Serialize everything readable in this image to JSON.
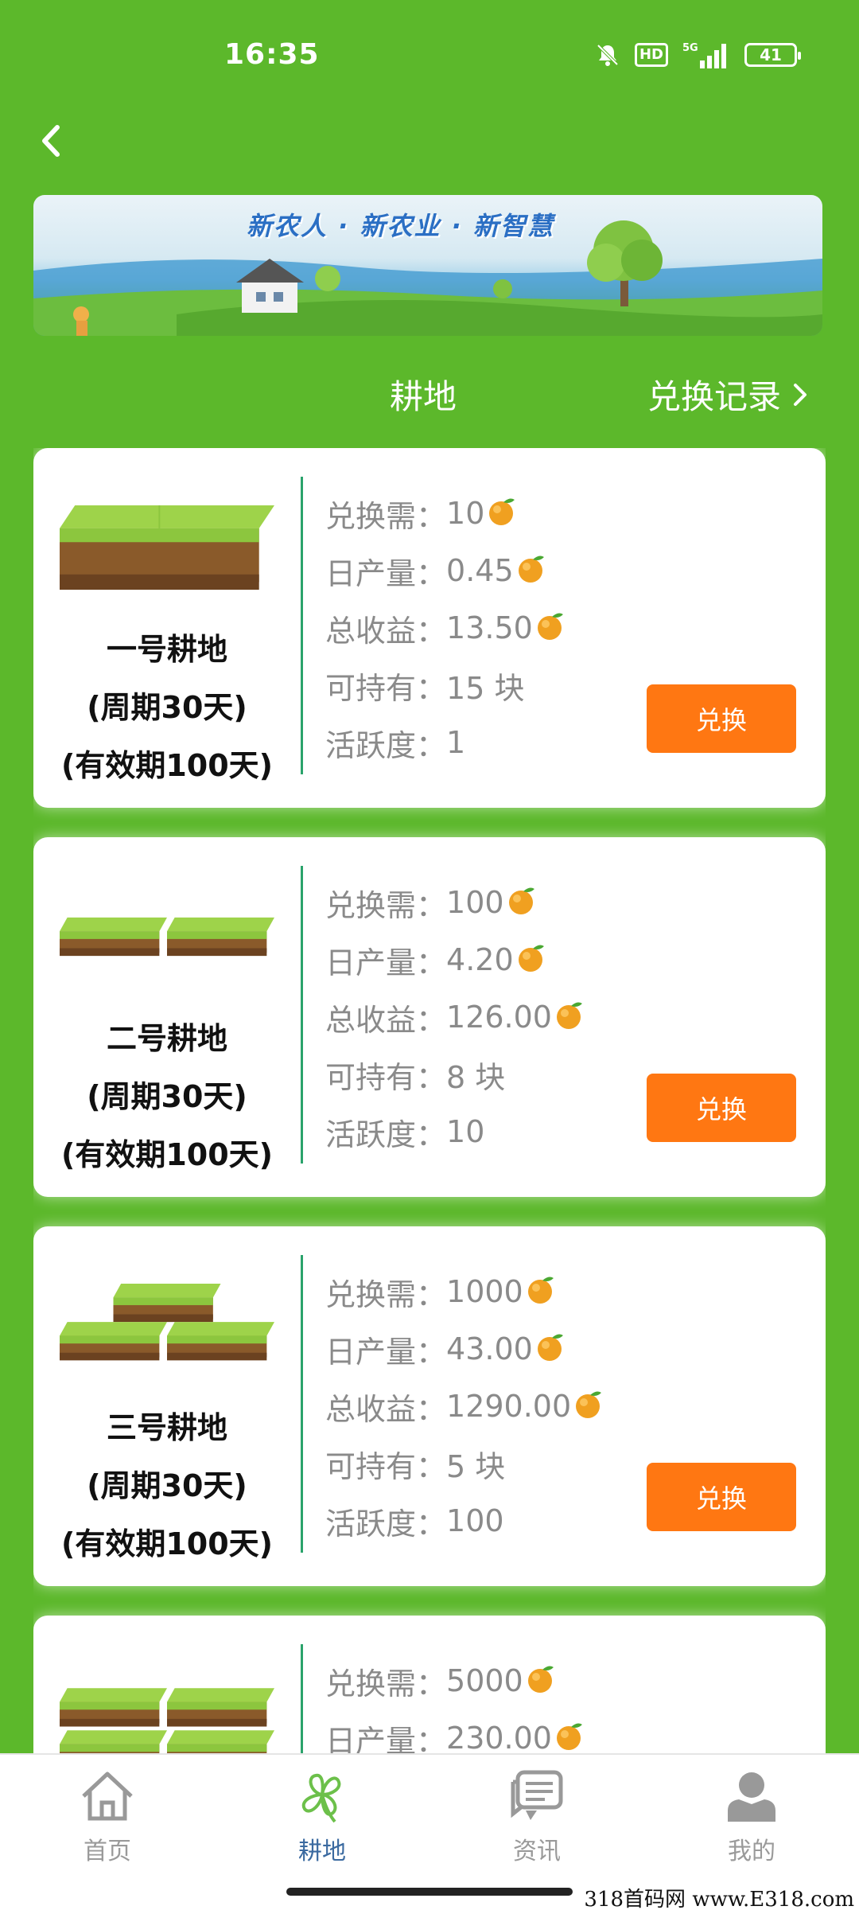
{
  "status_bar": {
    "time": "16:35",
    "hd_label": "HD",
    "network_label": "5G",
    "battery_level": "41",
    "icons": [
      "bell-muted-icon",
      "hd-icon",
      "signal-5g-icon",
      "battery-icon"
    ]
  },
  "header": {
    "back_icon": "chevron-left-icon",
    "banner_slogan": "新农人 · 新农业 · 新智慧"
  },
  "tabs": {
    "title": "耕地",
    "record_link": "兑换记录"
  },
  "colors": {
    "background": "#5cb82b",
    "button": "#ff7712",
    "divider": "#2aa36b",
    "nav_active": "#3b6aa0"
  },
  "labels": {
    "cost": "兑换需：",
    "daily": "日产量：",
    "total": "总收益：",
    "hold": "可持有：",
    "activity": "活跃度：",
    "button": "兑换"
  },
  "cards": [
    {
      "name": "一号耕地",
      "cycle": "(周期30天)",
      "validity": "(有效期100天)",
      "cost": "10",
      "daily": "0.45",
      "total": "13.50",
      "hold": "15 块",
      "activity": "1",
      "tiles": 1
    },
    {
      "name": "二号耕地",
      "cycle": "(周期30天)",
      "validity": "(有效期100天)",
      "cost": "100",
      "daily": "4.20",
      "total": "126.00",
      "hold": "8 块",
      "activity": "10",
      "tiles": 2
    },
    {
      "name": "三号耕地",
      "cycle": "(周期30天)",
      "validity": "(有效期100天)",
      "cost": "1000",
      "daily": "43.00",
      "total": "1290.00",
      "hold": "5 块",
      "activity": "100",
      "tiles": 3
    },
    {
      "name": "",
      "cycle": "",
      "validity": "",
      "cost": "5000",
      "daily": "230.00",
      "total": "",
      "hold": "",
      "activity": "",
      "tiles": 4
    }
  ],
  "bottom_nav": [
    {
      "label": "首页",
      "icon": "home-icon"
    },
    {
      "label": "耕地",
      "icon": "clover-icon"
    },
    {
      "label": "资讯",
      "icon": "message-icon"
    },
    {
      "label": "我的",
      "icon": "user-icon"
    }
  ],
  "watermark": "318首码网  www.E318.com"
}
